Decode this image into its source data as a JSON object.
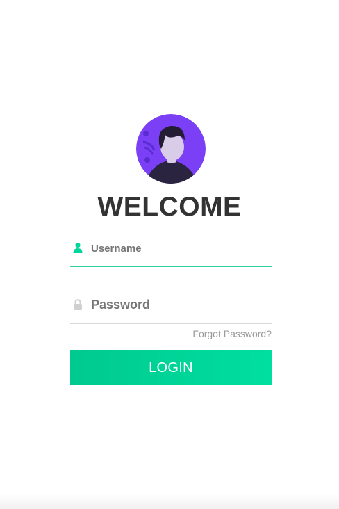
{
  "header": {
    "title": "WELCOME",
    "avatar_icon": "user-avatar-icon"
  },
  "form": {
    "username": {
      "placeholder": "Username",
      "value": "",
      "icon": "user-icon"
    },
    "password": {
      "placeholder": "Password",
      "value": "",
      "icon": "lock-icon"
    },
    "forgot_label": "Forgot Password?",
    "login_label": "LOGIN"
  },
  "colors": {
    "accent": "#00d69b",
    "avatar_bg": "#7b3ff5",
    "title": "#333333",
    "muted": "#9a9a9a",
    "lock_icon": "#d0d0d0"
  }
}
